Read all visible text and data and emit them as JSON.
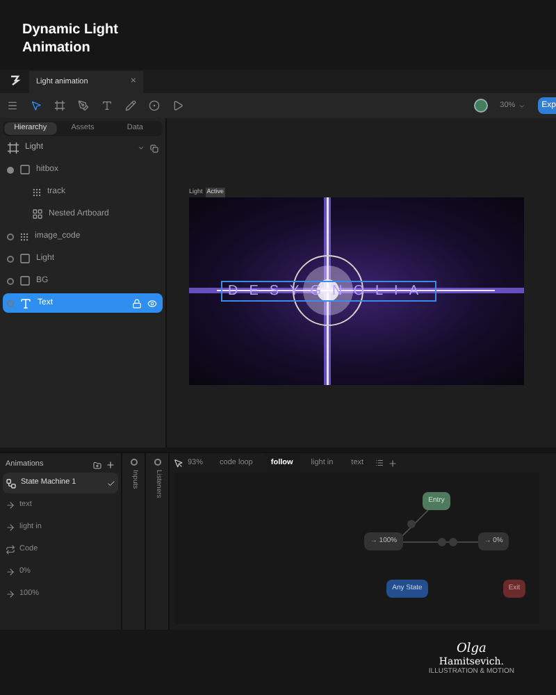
{
  "heading": {
    "lines": [
      "Dynamic Light",
      "Animation"
    ]
  },
  "window_tab": {
    "title": "Light animation",
    "close": "×"
  },
  "toolbar": {
    "zoom": "30%",
    "export_button": "Exp"
  },
  "hierarchy_tabs": [
    {
      "label": "Hierarchy",
      "selected": true
    },
    {
      "label": "Assets",
      "selected": false
    },
    {
      "label": "Data",
      "selected": false
    }
  ],
  "tree": {
    "label": "Light",
    "kind": "artboard",
    "children": [
      {
        "label": "hitbox",
        "kind": "group",
        "expanded": true,
        "selected": false,
        "children": [
          {
            "label": "track",
            "kind": "bone",
            "selected": false
          },
          {
            "label": "Nested Artboard",
            "kind": "nested",
            "selected": false
          }
        ]
      },
      {
        "label": "image_code",
        "kind": "bone",
        "expanded": false,
        "selected": false
      },
      {
        "label": "Light",
        "kind": "group",
        "expanded": false,
        "selected": false
      },
      {
        "label": "BG",
        "kind": "group",
        "expanded": false,
        "selected": false
      },
      {
        "label": "Text",
        "kind": "text",
        "expanded": false,
        "selected": true
      }
    ]
  },
  "canvas": {
    "artboard_name": "Light",
    "artboard_badge": "Active",
    "artwork_text": "DESYGNOLIA"
  },
  "animations": {
    "title": "Animations",
    "items": [
      {
        "label": "State Machine 1",
        "kind": "state_machine",
        "selected": true
      },
      {
        "label": "text",
        "kind": "one_shot",
        "selected": false
      },
      {
        "label": "light in",
        "kind": "one_shot",
        "selected": false
      },
      {
        "label": "Code",
        "kind": "loop",
        "selected": false
      },
      {
        "label": "0%",
        "kind": "one_shot",
        "selected": false
      },
      {
        "label": "100%",
        "kind": "one_shot",
        "selected": false
      }
    ]
  },
  "side_columns": [
    {
      "label": "Inputs"
    },
    {
      "label": "Listeners"
    }
  ],
  "state_machine": {
    "zoom": "93%",
    "layers": [
      {
        "label": "code loop",
        "selected": false
      },
      {
        "label": "follow",
        "selected": true
      },
      {
        "label": "light in",
        "selected": false
      },
      {
        "label": "text",
        "selected": false
      }
    ],
    "nodes": [
      {
        "label": "Entry",
        "kind": "entry"
      },
      {
        "label": "→ 100%",
        "kind": "state"
      },
      {
        "label": "→ 0%",
        "kind": "state"
      },
      {
        "label": "Any State",
        "kind": "any"
      },
      {
        "label": "Exit",
        "kind": "exit"
      }
    ]
  },
  "signature": {
    "name_top": "Olga",
    "name": "Hamitsevich.",
    "tagline": "ILLUSTRATION & MOTION"
  }
}
